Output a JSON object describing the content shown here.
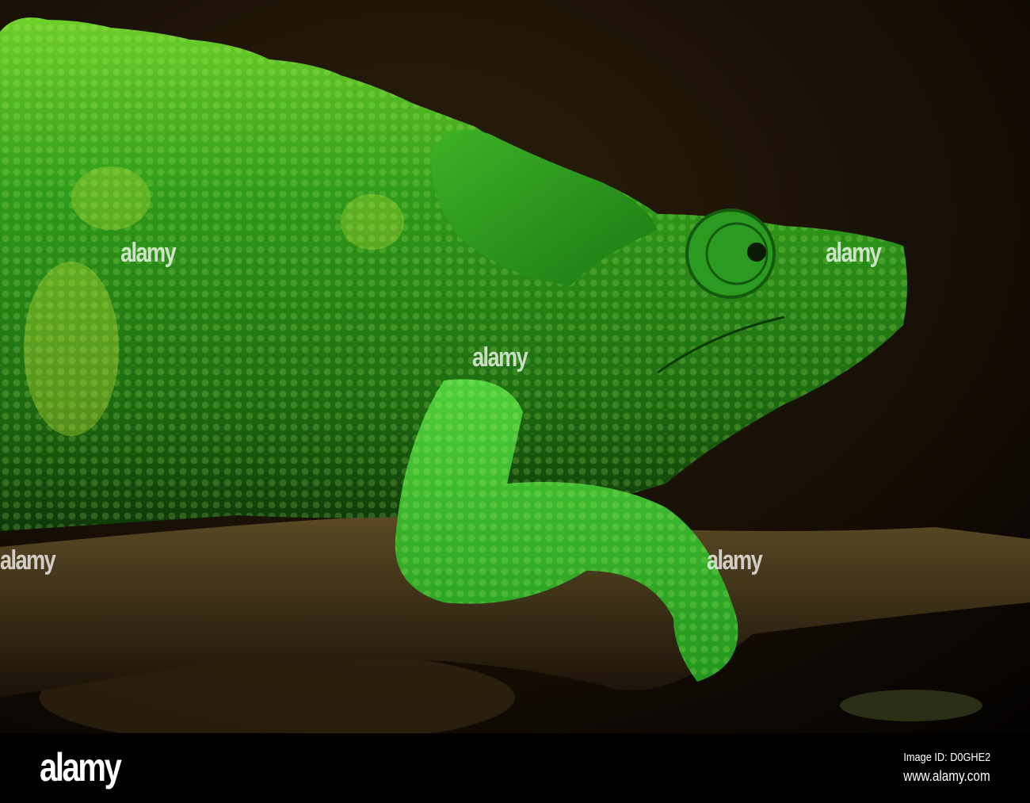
{
  "footer": {
    "logo": "alamy",
    "image_id": "Image ID: D0GHE2",
    "url": "www.alamy.com"
  },
  "watermark": "alamy",
  "colors": {
    "background": "#1c1408",
    "skin": "#2fa51c",
    "skin_highlight": "#b6e23a",
    "branch": "#4a3a1c"
  }
}
